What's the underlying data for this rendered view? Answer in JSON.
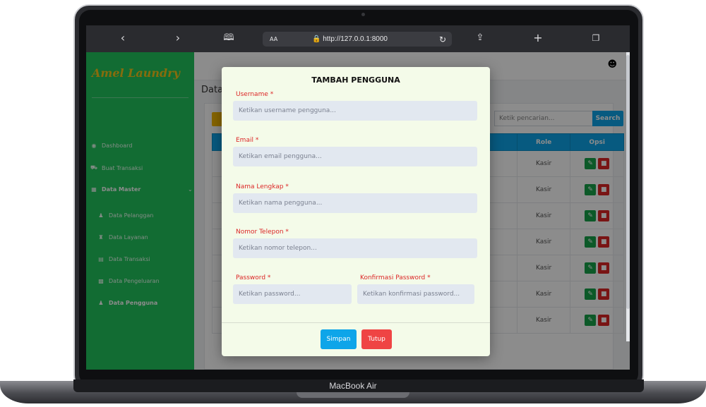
{
  "device": {
    "label": "MacBook Air"
  },
  "browser": {
    "url": "http://127.0.0.1:8000",
    "aa_label": "AA",
    "back_icon": "chevron-left",
    "forward_icon": "chevron-right",
    "bookmarks_icon": "book",
    "share_icon": "share",
    "new_tab_icon": "plus",
    "tabs_icon": "tabs"
  },
  "app": {
    "brand": "Amel Laundry",
    "accent": "#22c55e",
    "sidebar": {
      "items": [
        {
          "label": "Dashboard",
          "icon": "gauge-icon"
        },
        {
          "label": "Buat Transaksi",
          "icon": "cart-icon"
        },
        {
          "label": "Data Master",
          "icon": "table-icon"
        },
        {
          "label": "Data Pelanggan",
          "icon": "users-icon"
        },
        {
          "label": "Data Layanan",
          "icon": "shirt-icon"
        },
        {
          "label": "Data Transaksi",
          "icon": "file-icon"
        },
        {
          "label": "Data Pengeluaran",
          "icon": "money-icon"
        },
        {
          "label": "Data Pengguna",
          "icon": "user-group-icon"
        }
      ]
    },
    "page_title": "Data",
    "search": {
      "placeholder": "Ketik pencarian...",
      "button": "Search"
    },
    "table": {
      "headers": [
        "Role",
        "Opsi"
      ],
      "rows": [
        "Kasir",
        "Kasir",
        "Kasir",
        "Kasir",
        "Kasir",
        "Kasir",
        "Kasir"
      ]
    }
  },
  "modal": {
    "title": "TAMBAH PENGGUNA",
    "fields": {
      "username": {
        "label": "Username *",
        "placeholder": "Ketikan username pengguna..."
      },
      "email": {
        "label": "Email *",
        "placeholder": "Ketikan email pengguna..."
      },
      "fullname": {
        "label": "Nama Lengkap *",
        "placeholder": "Ketikan nama pengguna..."
      },
      "phone": {
        "label": "Nomor Telepon *",
        "placeholder": "Ketikan nomor telepon..."
      },
      "password": {
        "label": "Password *",
        "placeholder": "Ketikan password..."
      },
      "confirm": {
        "label": "Konfirmasi Password *",
        "placeholder": "Ketikan konfirmasi password..."
      }
    },
    "save_label": "Simpan",
    "close_label": "Tutup"
  }
}
